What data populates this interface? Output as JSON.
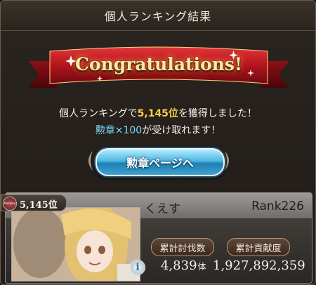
{
  "header": {
    "title": "個人ランキング結果"
  },
  "banner": {
    "text": "Congratulations!"
  },
  "message": {
    "line1_prefix": "個人ランキングで",
    "line1_rank": "5,145位",
    "line1_suffix": "を獲得しました！",
    "line2_reward": "勲章×100",
    "line2_suffix": "が受け取れます！"
  },
  "medal_button": {
    "label": "勲章ページへ"
  },
  "card": {
    "rank_badge": "5,145位",
    "rank_icon_text": "Ranking",
    "player_name": "くえす",
    "player_rank": "Rank226",
    "labels": {
      "kills": "累計討伐数",
      "contribution": "累計貢献度"
    },
    "kills_value": "4,839",
    "kills_unit": "体",
    "contribution_value": "1,927,892,359",
    "info_icon": "i"
  },
  "colors": {
    "accent_gold": "#f7cf46",
    "accent_blue": "#7fd9ff",
    "ribbon_red": "#b5141c",
    "button_blue": "#4fb7e3"
  },
  "icons": [
    "info-icon",
    "ranking-icon",
    "sparkle-icon"
  ]
}
